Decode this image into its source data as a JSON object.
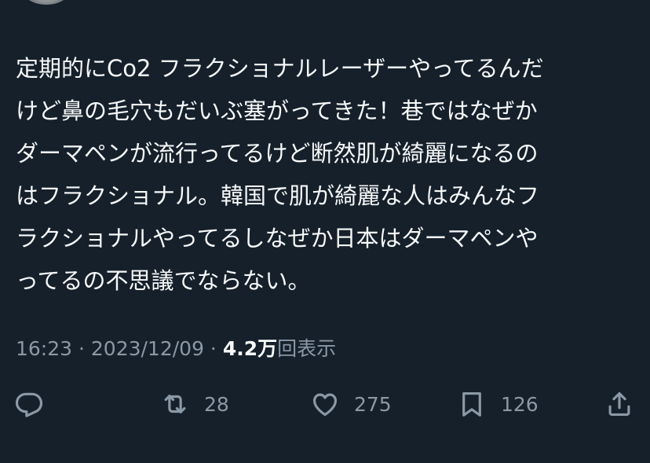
{
  "tweet": {
    "lines": [
      "定期的にCo2 フラクショナルレーザーやってるんだ",
      "けど鼻の毛穴もだいぶ塞がってきた！巷ではなぜか",
      "ダーマペンが流行ってるけど断然肌が綺麗になるの",
      "はフラクショナル。韓国で肌が綺麗な人はみんなフ",
      "ラクショナルやってるしなぜか日本はダーマペンや",
      "ってるの不思議でならない。"
    ]
  },
  "meta": {
    "time": "16:23",
    "separator1": " · ",
    "date": "2023/12/09",
    "separator2": " · ",
    "views_count": "4.2万",
    "views_label": "回表示"
  },
  "actions": {
    "reply": {
      "icon": "reply-icon"
    },
    "retweet": {
      "icon": "retweet-icon",
      "count": "28"
    },
    "like": {
      "icon": "heart-icon",
      "count": "275"
    },
    "bookmark": {
      "icon": "bookmark-icon",
      "count": "126"
    },
    "share": {
      "icon": "share-icon"
    }
  },
  "colors": {
    "background": "#15202b",
    "text": "#f7f9f9",
    "secondary": "#8b98a5"
  }
}
